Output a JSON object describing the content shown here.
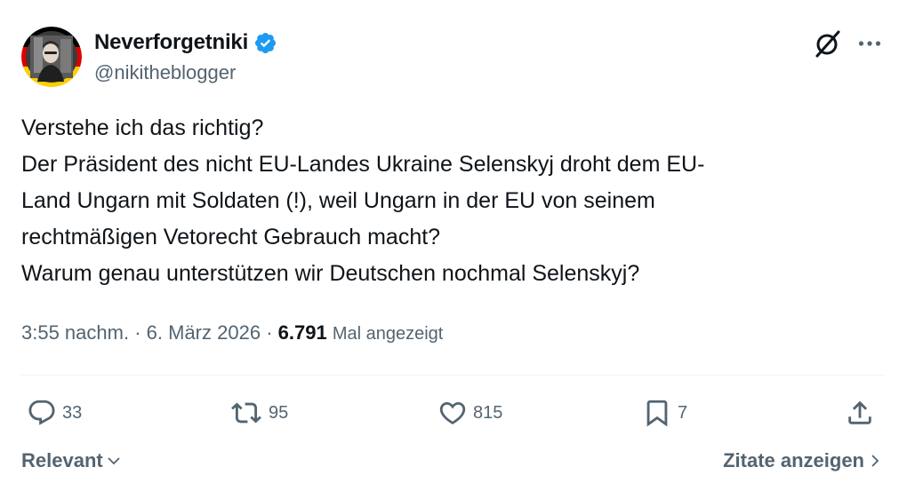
{
  "author": {
    "display_name": "Neverforgetniki",
    "handle": "@nikitheblogger",
    "verified": true,
    "verified_color": "#1d9bf0"
  },
  "header_icons": [
    "grok-icon",
    "more-icon"
  ],
  "tweet": {
    "lines": [
      "Verstehe ich das richtig?",
      "Der Präsident des nicht EU-Landes Ukraine Selenskyj droht dem EU-",
      "Land Ungarn mit Soldaten (!), weil Ungarn in der EU von seinem",
      "rechtmäßigen Vetorecht Gebrauch macht?",
      "Warum genau unterstützen wir Deutschen nochmal Selenskyj?"
    ]
  },
  "meta": {
    "time": "3:55 nachm.",
    "separator": "·",
    "date": "6. März 2026",
    "views_count": "6.791",
    "views_label": "Mal angezeigt"
  },
  "actions": {
    "replies": "33",
    "reposts": "95",
    "likes": "815",
    "bookmarks": "7"
  },
  "footer": {
    "sort_label": "Relevant",
    "quotes_label": "Zitate anzeigen"
  },
  "colors": {
    "text_primary": "#0f1419",
    "text_secondary": "#536471",
    "divider": "#eff3f4",
    "flag_black": "#000000",
    "flag_red": "#dd0000",
    "flag_gold": "#ffce00"
  }
}
